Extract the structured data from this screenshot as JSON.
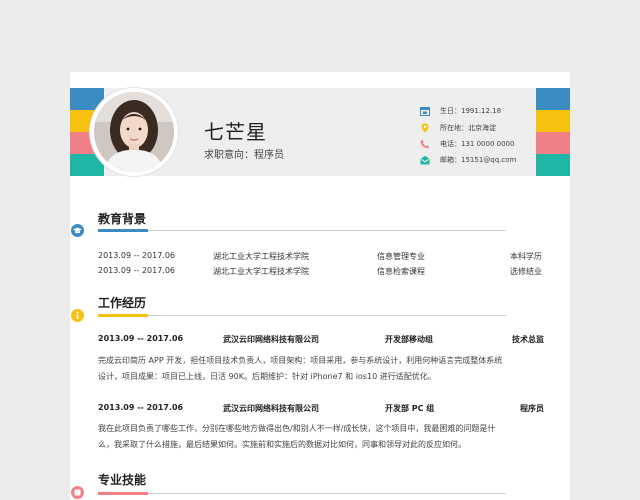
{
  "profile": {
    "name": "七芒星",
    "intent": "求职意向：程序员",
    "birth": "生日：1991.12.18",
    "location": "所在地：北京海淀",
    "phone": "电话：131    0000    0000",
    "email": "邮箱：15151@qq.com"
  },
  "education": {
    "title": "教育背景",
    "rows": [
      {
        "date": "2013.09 -- 2017.06",
        "school": "湖北工业大学工程技术学院",
        "major": "信息管理专业",
        "degree": "本科学历"
      },
      {
        "date": "2013.09 -- 2017.06",
        "school": "湖北工业大学工程技术学院",
        "major": "信息检索课程",
        "degree": "选修结业"
      }
    ]
  },
  "work": {
    "title": "工作经历",
    "jobs": [
      {
        "date": "2013.09 -- 2017.06",
        "company": "武汉云印网络科技有限公司",
        "dept": "开发部移动组",
        "role": "技术总监",
        "description": "完成云印简历 APP 开发，担任项目技术负责人，项目架构：项目采用，参与系统设计，利用何种语言完成整体系统设计，项目成果：项目已上线，日活 90K。后期维护：针对 iPhone7 和 ios10 进行适配优化。"
      },
      {
        "date": "2013.09 -- 2017.06",
        "company": "武汉云印网络科技有限公司",
        "dept": "开发部 PC 组",
        "role": "程序员",
        "description": "我在此项目负责了哪些工作，分别在哪些地方做得出色/和别人不一样/成长快，这个项目中，我最困难的问题是什么，我采取了什么措施，最后结果如何。实施前和实施后的数据对比如何，同事和领导对此的反应如何。"
      }
    ]
  },
  "skills": {
    "title": "专业技能"
  },
  "colors": {
    "blue": "#3b8cc2",
    "yellow": "#f6c20f",
    "pink": "#f07f87",
    "teal": "#1fb6a6"
  },
  "icons": [
    "calendar-icon",
    "location-pin-icon",
    "phone-icon",
    "envelope-icon",
    "graduation-cap-icon",
    "info-icon",
    "skills-icon"
  ]
}
